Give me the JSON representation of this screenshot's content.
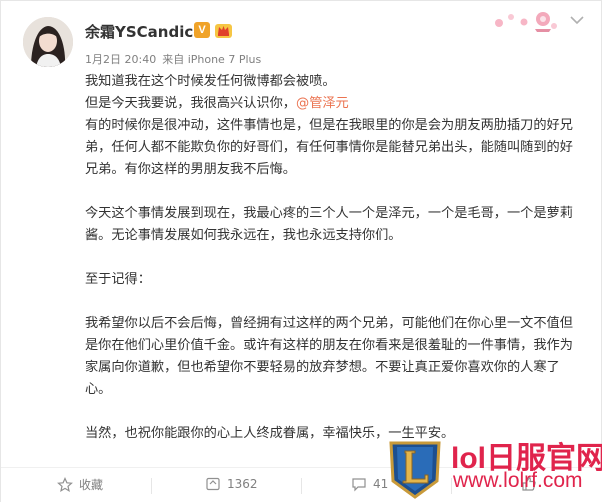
{
  "post": {
    "author": "余霜YSCandice",
    "verified_badge": "V",
    "time": "1月2日 20:40",
    "source": "来自 iPhone 7 Plus",
    "lines": {
      "l1": "我知道我在这个时候发任何微博都会被喷。",
      "l2_pre": "但是今天我要说，我很高兴认识你，",
      "l2_mention": "@管泽元",
      "l3": "有的时候你是很冲动，这件事情也是，但是在我眼里的你是会为朋友两肋插刀的好兄弟，任何人都不能欺负你的好哥们，有任何事情你是能替兄弟出头，能随叫随到的好兄弟。有你这样的男朋友我不后悔。",
      "l4": "今天这个事情发展到现在，我最心疼的三个人一个是泽元，一个是毛哥，一个是萝莉酱。无论事情发展如何我永远在，我也永远支持你们。",
      "l5": "至于记得：",
      "l6": "我希望你以后不会后悔，曾经拥有过这样的两个兄弟，可能他们在你心里一文不值但是你在他们心里价值千金。或许有这样的朋友在你看来是很羞耻的一件事情，我作为家属向你道歉，但也希望你不要轻易的放弃梦想。不要让真正爱你喜欢你的人寒了心。",
      "l7": "当然，也祝你能跟你的心上人终成眷属，幸福快乐，一生平安。"
    }
  },
  "footer": {
    "collect_label": "收藏",
    "repost_count": "1362",
    "comment_count": "41",
    "like_count": ""
  },
  "watermark": {
    "title": "lol日服官网",
    "url": "www.lolrf.com"
  },
  "colors": {
    "mention": "#eb7350",
    "watermark": "#e0244c",
    "verified": "#f0a329"
  },
  "icons": [
    "avatar-photo",
    "verified-icon",
    "crown-icon",
    "flower-decoration",
    "chevron-down-icon",
    "star-icon",
    "repost-icon",
    "comment-icon",
    "like-icon",
    "lol-logo"
  ]
}
